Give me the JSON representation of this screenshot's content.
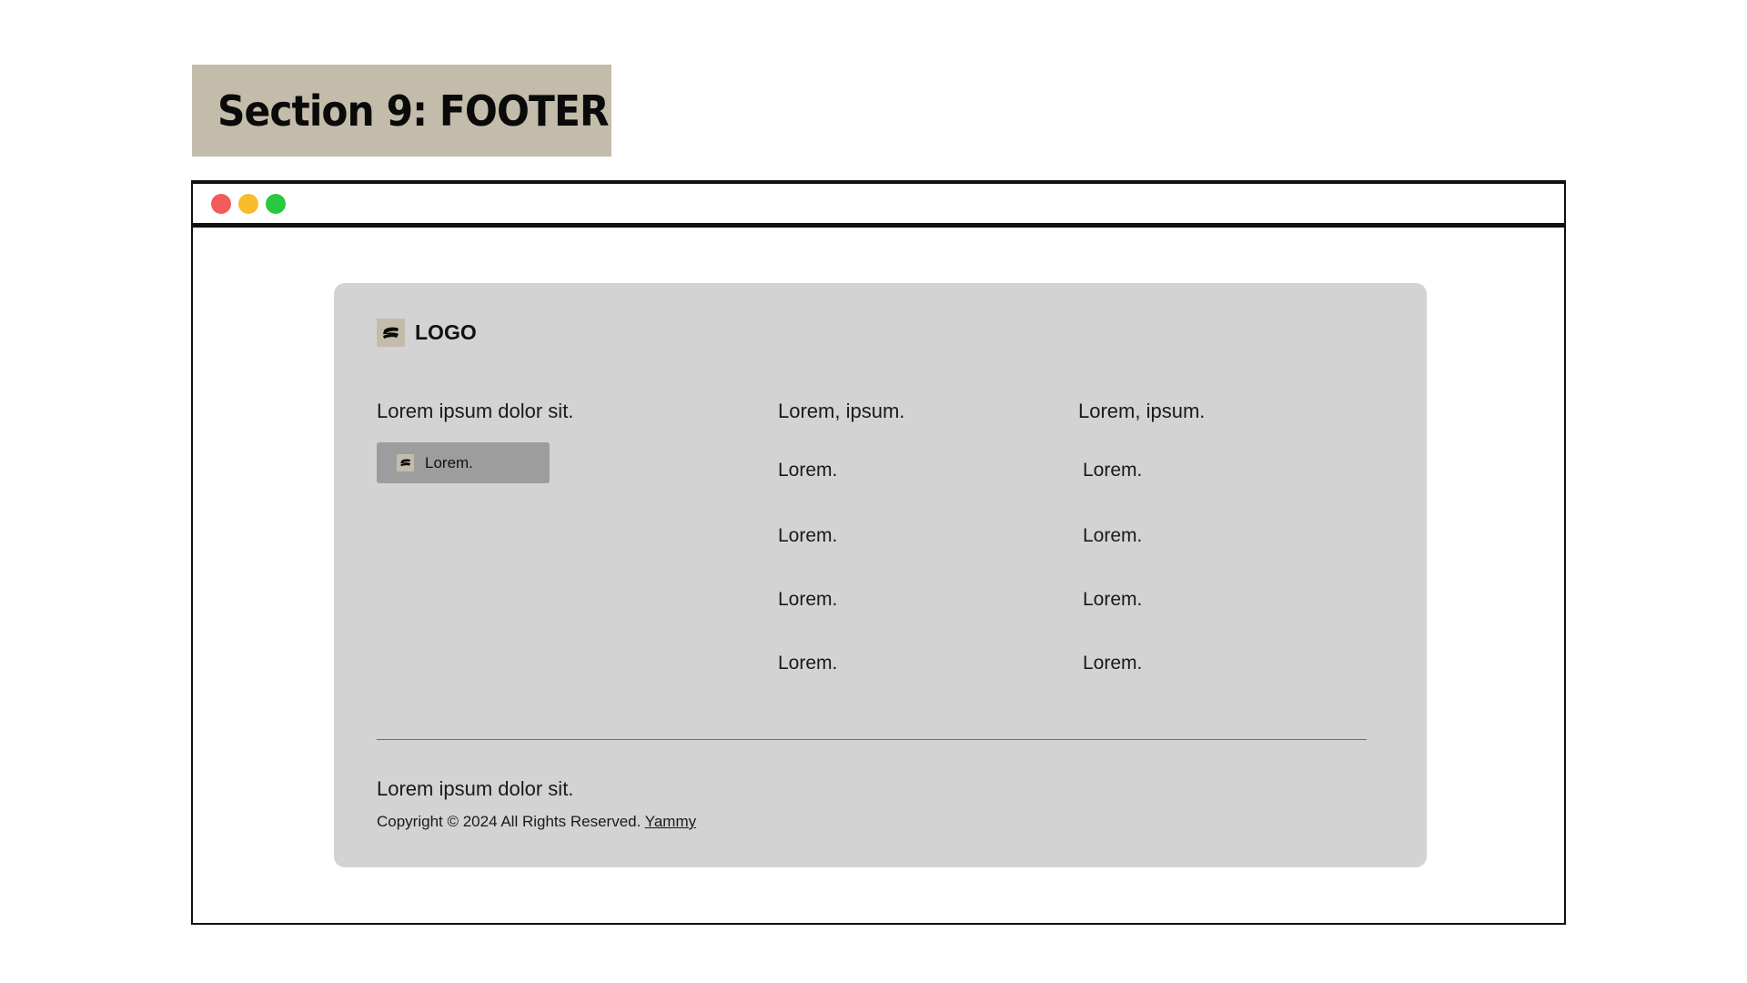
{
  "section": {
    "title": "Section 9: FOOTER"
  },
  "window_controls": {
    "close_color": "#f25b5b",
    "minimize_color": "#f7bc2c",
    "maximize_color": "#28c840"
  },
  "footer": {
    "background_color": "#d2d3d2",
    "logo": {
      "icon": "brush-stroke-icon",
      "text": "LOGO"
    },
    "tagline": "Lorem ipsum dolor sit.",
    "cta_button": {
      "icon": "brush-stroke-icon",
      "label": "Lorem."
    },
    "columns": [
      {
        "heading": "Lorem, ipsum.",
        "links": [
          "Lorem.",
          "Lorem.",
          "Lorem.",
          "Lorem."
        ]
      },
      {
        "heading": "Lorem, ipsum.",
        "links": [
          "Lorem.",
          "Lorem.",
          "Lorem.",
          "Lorem."
        ]
      }
    ],
    "bottom": {
      "tagline": "Lorem ipsum dolor sit.",
      "copyright_text": "Copyright © 2024 All Rights Reserved. ",
      "brand_link": "Yammy"
    }
  },
  "colors": {
    "banner": "#c4bcab",
    "button": "#9d9d9d"
  }
}
